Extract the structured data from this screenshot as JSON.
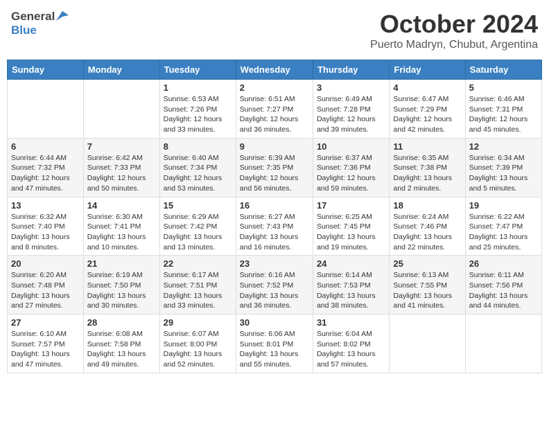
{
  "header": {
    "logo_general": "General",
    "logo_blue": "Blue",
    "month": "October 2024",
    "location": "Puerto Madryn, Chubut, Argentina"
  },
  "days_of_week": [
    "Sunday",
    "Monday",
    "Tuesday",
    "Wednesday",
    "Thursday",
    "Friday",
    "Saturday"
  ],
  "weeks": [
    [
      {
        "day": "",
        "info": ""
      },
      {
        "day": "",
        "info": ""
      },
      {
        "day": "1",
        "info": "Sunrise: 6:53 AM\nSunset: 7:26 PM\nDaylight: 12 hours\nand 33 minutes."
      },
      {
        "day": "2",
        "info": "Sunrise: 6:51 AM\nSunset: 7:27 PM\nDaylight: 12 hours\nand 36 minutes."
      },
      {
        "day": "3",
        "info": "Sunrise: 6:49 AM\nSunset: 7:28 PM\nDaylight: 12 hours\nand 39 minutes."
      },
      {
        "day": "4",
        "info": "Sunrise: 6:47 AM\nSunset: 7:29 PM\nDaylight: 12 hours\nand 42 minutes."
      },
      {
        "day": "5",
        "info": "Sunrise: 6:46 AM\nSunset: 7:31 PM\nDaylight: 12 hours\nand 45 minutes."
      }
    ],
    [
      {
        "day": "6",
        "info": "Sunrise: 6:44 AM\nSunset: 7:32 PM\nDaylight: 12 hours\nand 47 minutes."
      },
      {
        "day": "7",
        "info": "Sunrise: 6:42 AM\nSunset: 7:33 PM\nDaylight: 12 hours\nand 50 minutes."
      },
      {
        "day": "8",
        "info": "Sunrise: 6:40 AM\nSunset: 7:34 PM\nDaylight: 12 hours\nand 53 minutes."
      },
      {
        "day": "9",
        "info": "Sunrise: 6:39 AM\nSunset: 7:35 PM\nDaylight: 12 hours\nand 56 minutes."
      },
      {
        "day": "10",
        "info": "Sunrise: 6:37 AM\nSunset: 7:36 PM\nDaylight: 12 hours\nand 59 minutes."
      },
      {
        "day": "11",
        "info": "Sunrise: 6:35 AM\nSunset: 7:38 PM\nDaylight: 13 hours\nand 2 minutes."
      },
      {
        "day": "12",
        "info": "Sunrise: 6:34 AM\nSunset: 7:39 PM\nDaylight: 13 hours\nand 5 minutes."
      }
    ],
    [
      {
        "day": "13",
        "info": "Sunrise: 6:32 AM\nSunset: 7:40 PM\nDaylight: 13 hours\nand 8 minutes."
      },
      {
        "day": "14",
        "info": "Sunrise: 6:30 AM\nSunset: 7:41 PM\nDaylight: 13 hours\nand 10 minutes."
      },
      {
        "day": "15",
        "info": "Sunrise: 6:29 AM\nSunset: 7:42 PM\nDaylight: 13 hours\nand 13 minutes."
      },
      {
        "day": "16",
        "info": "Sunrise: 6:27 AM\nSunset: 7:43 PM\nDaylight: 13 hours\nand 16 minutes."
      },
      {
        "day": "17",
        "info": "Sunrise: 6:25 AM\nSunset: 7:45 PM\nDaylight: 13 hours\nand 19 minutes."
      },
      {
        "day": "18",
        "info": "Sunrise: 6:24 AM\nSunset: 7:46 PM\nDaylight: 13 hours\nand 22 minutes."
      },
      {
        "day": "19",
        "info": "Sunrise: 6:22 AM\nSunset: 7:47 PM\nDaylight: 13 hours\nand 25 minutes."
      }
    ],
    [
      {
        "day": "20",
        "info": "Sunrise: 6:20 AM\nSunset: 7:48 PM\nDaylight: 13 hours\nand 27 minutes."
      },
      {
        "day": "21",
        "info": "Sunrise: 6:19 AM\nSunset: 7:50 PM\nDaylight: 13 hours\nand 30 minutes."
      },
      {
        "day": "22",
        "info": "Sunrise: 6:17 AM\nSunset: 7:51 PM\nDaylight: 13 hours\nand 33 minutes."
      },
      {
        "day": "23",
        "info": "Sunrise: 6:16 AM\nSunset: 7:52 PM\nDaylight: 13 hours\nand 36 minutes."
      },
      {
        "day": "24",
        "info": "Sunrise: 6:14 AM\nSunset: 7:53 PM\nDaylight: 13 hours\nand 38 minutes."
      },
      {
        "day": "25",
        "info": "Sunrise: 6:13 AM\nSunset: 7:55 PM\nDaylight: 13 hours\nand 41 minutes."
      },
      {
        "day": "26",
        "info": "Sunrise: 6:11 AM\nSunset: 7:56 PM\nDaylight: 13 hours\nand 44 minutes."
      }
    ],
    [
      {
        "day": "27",
        "info": "Sunrise: 6:10 AM\nSunset: 7:57 PM\nDaylight: 13 hours\nand 47 minutes."
      },
      {
        "day": "28",
        "info": "Sunrise: 6:08 AM\nSunset: 7:58 PM\nDaylight: 13 hours\nand 49 minutes."
      },
      {
        "day": "29",
        "info": "Sunrise: 6:07 AM\nSunset: 8:00 PM\nDaylight: 13 hours\nand 52 minutes."
      },
      {
        "day": "30",
        "info": "Sunrise: 6:06 AM\nSunset: 8:01 PM\nDaylight: 13 hours\nand 55 minutes."
      },
      {
        "day": "31",
        "info": "Sunrise: 6:04 AM\nSunset: 8:02 PM\nDaylight: 13 hours\nand 57 minutes."
      },
      {
        "day": "",
        "info": ""
      },
      {
        "day": "",
        "info": ""
      }
    ]
  ]
}
